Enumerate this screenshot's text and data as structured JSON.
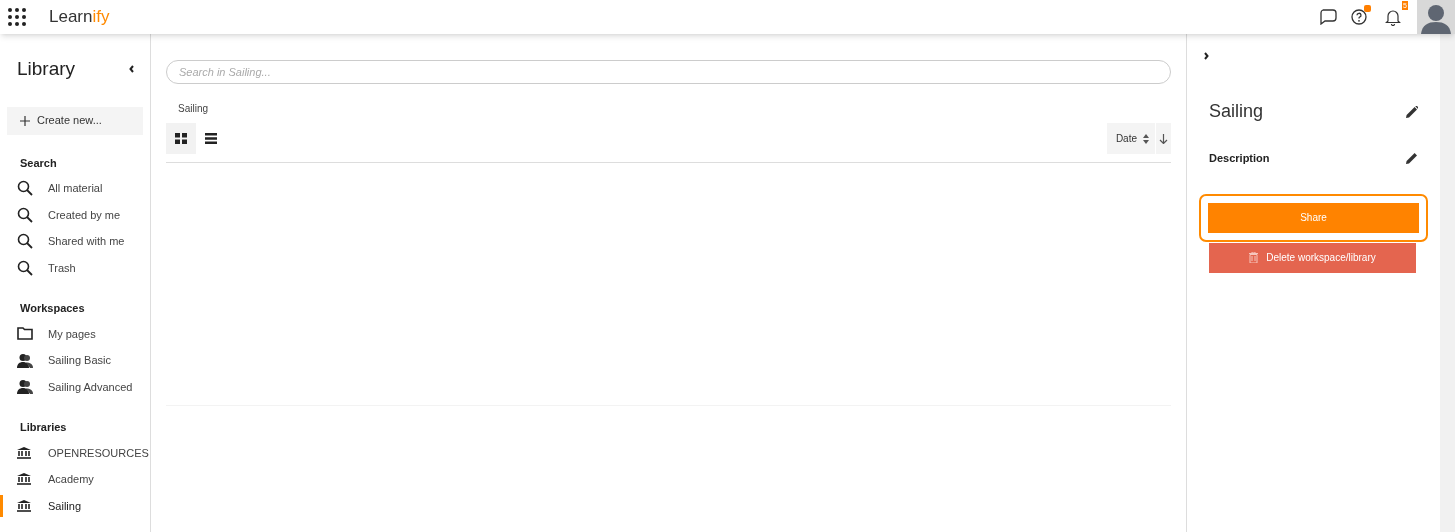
{
  "header": {
    "logo": {
      "main": "Learn",
      "accent": "ify"
    },
    "notifications": "5",
    "help_unread": true
  },
  "sidebar": {
    "title": "Library",
    "create_button": "Create new...",
    "sections": [
      {
        "title": "Search",
        "items": [
          {
            "label": "All material",
            "kind": "search",
            "selected": false
          },
          {
            "label": "Created by me",
            "kind": "search",
            "selected": false
          },
          {
            "label": "Shared with me",
            "kind": "search",
            "selected": false
          },
          {
            "label": "Trash",
            "kind": "search",
            "selected": false
          }
        ]
      },
      {
        "title": "Workspaces",
        "items": [
          {
            "label": "My pages",
            "kind": "folder",
            "selected": false
          },
          {
            "label": "Sailing Basic",
            "kind": "group",
            "selected": false
          },
          {
            "label": "Sailing Advanced",
            "kind": "group",
            "selected": false
          }
        ]
      },
      {
        "title": "Libraries",
        "items": [
          {
            "label": "OPENRESOURCES",
            "kind": "library",
            "selected": false
          },
          {
            "label": "Academy",
            "kind": "library",
            "selected": false
          },
          {
            "label": "Sailing",
            "kind": "library",
            "selected": true
          }
        ]
      }
    ]
  },
  "main": {
    "search": {
      "placeholder": "Search in Sailing..."
    },
    "breadcrumb": "Sailing",
    "views": [
      {
        "kind": "grid",
        "selected": true
      },
      {
        "kind": "list",
        "selected": false
      }
    ],
    "sort": {
      "label": "Date"
    }
  },
  "details": {
    "title": "Sailing",
    "description_label": "Description",
    "share_button": "Share",
    "delete_button": "Delete workspace/library"
  }
}
